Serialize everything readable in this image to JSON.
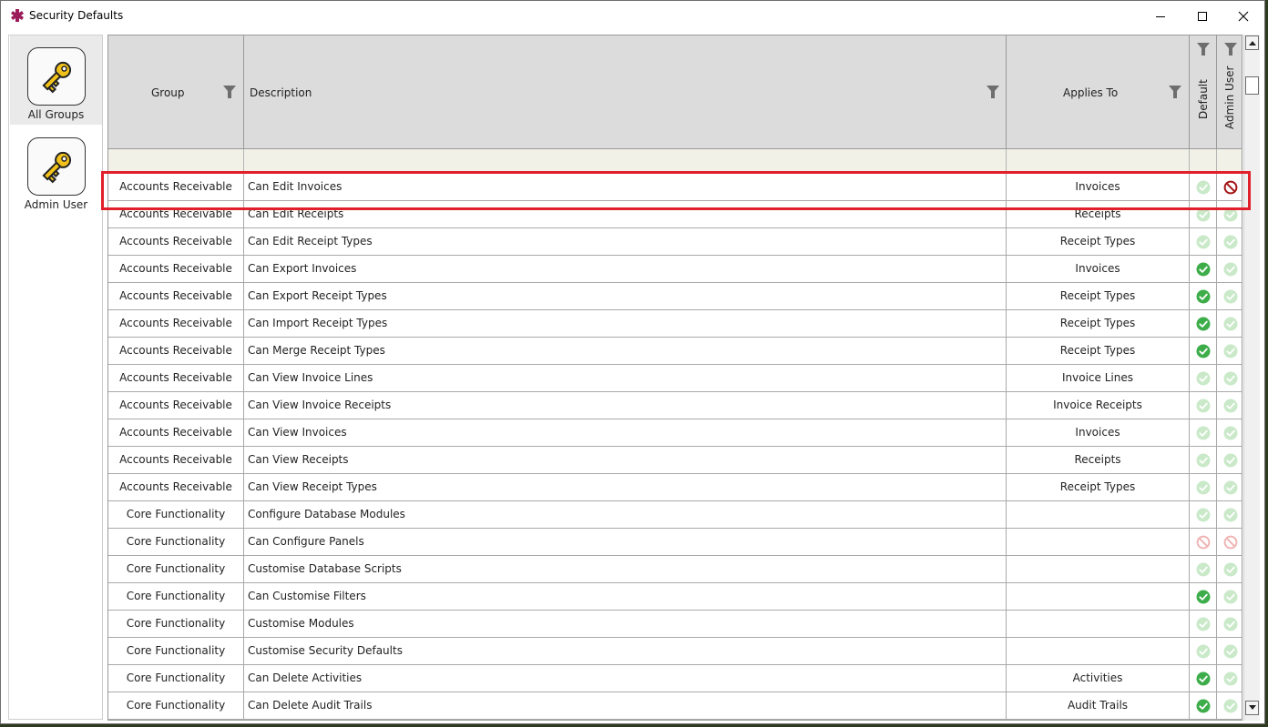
{
  "window": {
    "title": "Security Defaults"
  },
  "sidebar": {
    "items": [
      {
        "label": "All Groups",
        "icon": "key-icon",
        "active": true
      },
      {
        "label": "Admin User",
        "icon": "key-icon",
        "active": false
      }
    ]
  },
  "grid": {
    "columns": {
      "group": "Group",
      "description": "Description",
      "applies_to": "Applies To",
      "default": "Default",
      "admin_user": "Admin User"
    },
    "rows": [
      {
        "group": "Accounts Receivable",
        "description": "Can Edit Invoices",
        "applies_to": "Invoices",
        "default": "allow-faded",
        "admin": "deny"
      },
      {
        "group": "Accounts Receivable",
        "description": "Can Edit Receipts",
        "applies_to": "Receipts",
        "default": "allow-faded",
        "admin": "allow-faded"
      },
      {
        "group": "Accounts Receivable",
        "description": "Can Edit Receipt Types",
        "applies_to": "Receipt Types",
        "default": "allow-faded",
        "admin": "allow-faded"
      },
      {
        "group": "Accounts Receivable",
        "description": "Can Export Invoices",
        "applies_to": "Invoices",
        "default": "allow",
        "admin": "allow-faded"
      },
      {
        "group": "Accounts Receivable",
        "description": "Can Export Receipt Types",
        "applies_to": "Receipt Types",
        "default": "allow",
        "admin": "allow-faded"
      },
      {
        "group": "Accounts Receivable",
        "description": "Can Import Receipt Types",
        "applies_to": "Receipt Types",
        "default": "allow",
        "admin": "allow-faded"
      },
      {
        "group": "Accounts Receivable",
        "description": "Can Merge Receipt Types",
        "applies_to": "Receipt Types",
        "default": "allow",
        "admin": "allow-faded"
      },
      {
        "group": "Accounts Receivable",
        "description": "Can View Invoice Lines",
        "applies_to": "Invoice Lines",
        "default": "allow-faded",
        "admin": "allow-faded"
      },
      {
        "group": "Accounts Receivable",
        "description": "Can View Invoice Receipts",
        "applies_to": "Invoice Receipts",
        "default": "allow-faded",
        "admin": "allow-faded"
      },
      {
        "group": "Accounts Receivable",
        "description": "Can View Invoices",
        "applies_to": "Invoices",
        "default": "allow-faded",
        "admin": "allow-faded"
      },
      {
        "group": "Accounts Receivable",
        "description": "Can View Receipts",
        "applies_to": "Receipts",
        "default": "allow-faded",
        "admin": "allow-faded"
      },
      {
        "group": "Accounts Receivable",
        "description": "Can View Receipt Types",
        "applies_to": "Receipt Types",
        "default": "allow-faded",
        "admin": "allow-faded"
      },
      {
        "group": "Core Functionality",
        "description": "Configure Database Modules",
        "applies_to": "",
        "default": "allow-faded",
        "admin": "allow-faded"
      },
      {
        "group": "Core Functionality",
        "description": "Can Configure Panels",
        "applies_to": "",
        "default": "deny-faded",
        "admin": "deny-faded"
      },
      {
        "group": "Core Functionality",
        "description": "Customise Database Scripts",
        "applies_to": "",
        "default": "allow-faded",
        "admin": "allow-faded"
      },
      {
        "group": "Core Functionality",
        "description": "Can Customise Filters",
        "applies_to": "",
        "default": "allow",
        "admin": "allow-faded"
      },
      {
        "group": "Core Functionality",
        "description": "Customise Modules",
        "applies_to": "",
        "default": "allow-faded",
        "admin": "allow-faded"
      },
      {
        "group": "Core Functionality",
        "description": "Customise Security Defaults",
        "applies_to": "",
        "default": "allow-faded",
        "admin": "allow-faded"
      },
      {
        "group": "Core Functionality",
        "description": "Can Delete Activities",
        "applies_to": "Activities",
        "default": "allow",
        "admin": "allow-faded"
      },
      {
        "group": "Core Functionality",
        "description": "Can Delete Audit Trails",
        "applies_to": "Audit Trails",
        "default": "allow",
        "admin": "allow-faded"
      }
    ]
  },
  "colors": {
    "allow": "#3dad4a",
    "allow_faded": "#c9e9c9",
    "deny": "#a31515",
    "deny_faded": "#f0b5b5",
    "highlight": "#e0202a",
    "header_bg": "#dcdcdc",
    "filter_row_bg": "#f1f1e7"
  }
}
